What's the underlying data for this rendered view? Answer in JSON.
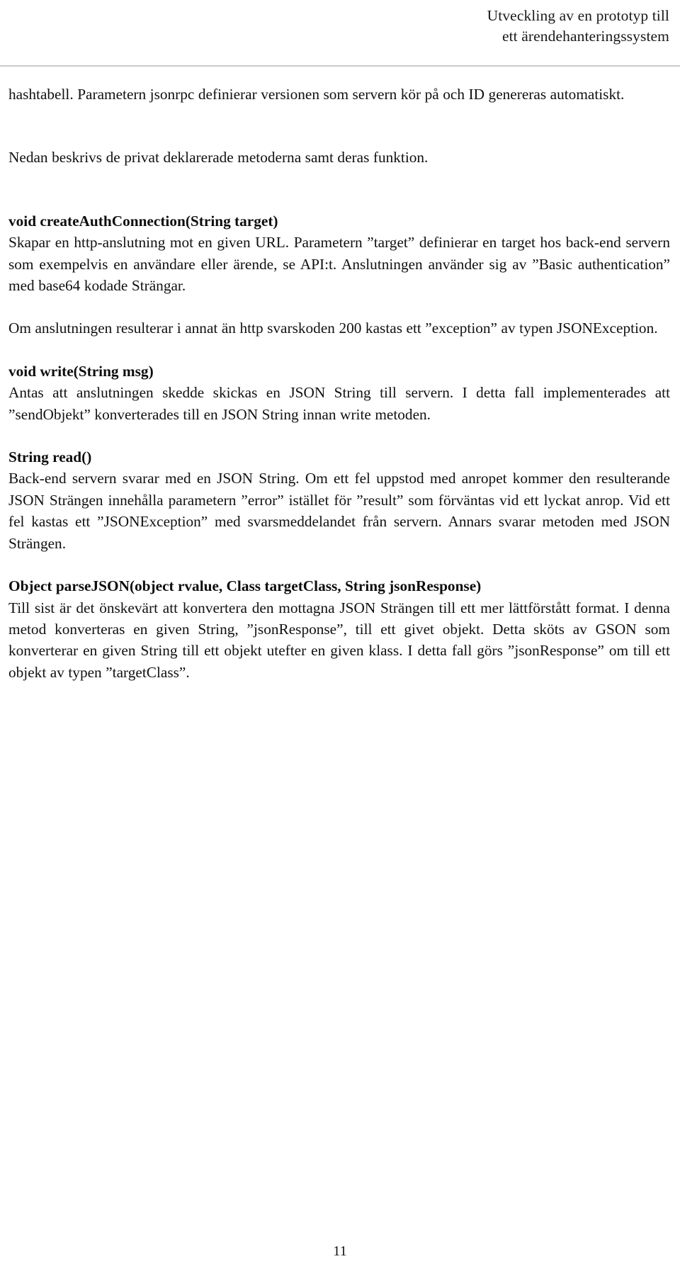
{
  "document": {
    "language": "sv",
    "page_number": "11",
    "header": {
      "line1": "Utveckling av en prototyp till",
      "line2": "ett ärendehanteringssystem"
    },
    "body": {
      "paragraph_continued": "hashtabell. Parametern jsonrpc definierar versionen som servern kör på och ID genereras automatiskt.",
      "paragraph_intro": "Nedan beskrivs de privat deklarerade metoderna samt deras funktion.",
      "sections": [
        {
          "heading": "void createAuthConnection(String target)",
          "paragraphs": [
            "Skapar en http-anslutning mot en given URL. Parametern ”target” definierar en target hos back-end servern som exempelvis en användare eller ärende, se API:t. Anslutningen använder sig av ”Basic authentication” med base64 kodade Strängar.",
            "Om anslutningen resulterar i annat än http svarskoden 200 kastas ett ”exception” av typen JSONException."
          ]
        },
        {
          "heading": "void write(String msg)",
          "paragraphs": [
            "Antas att anslutningen skedde skickas en JSON String till servern. I detta fall implementerades att ”sendObjekt” konverterades till en JSON String innan write metoden."
          ]
        },
        {
          "heading": "String read()",
          "paragraphs": [
            "Back-end servern svarar med en JSON String. Om ett fel uppstod med anropet kommer den resulterande JSON Strängen innehålla parametern ”error” istället för ”result” som förväntas vid ett lyckat anrop. Vid ett fel kastas ett ”JSONException” med svarsmeddelandet från servern. Annars svarar metoden med JSON Strängen."
          ]
        },
        {
          "heading": "Object parseJSON(object rvalue, Class targetClass, String jsonResponse)",
          "paragraphs": [
            "Till sist är det önskevärt att konvertera den mottagna JSON Strängen till ett mer lättförstått format. I denna metod konverteras en given String, ”jsonResponse”, till ett givet objekt. Detta sköts av GSON som konverterar en given String till ett objekt utefter en given klass. I detta fall görs ”jsonResponse” om till ett objekt av typen ”targetClass”."
          ]
        }
      ]
    },
    "colors": {
      "text": "#111111",
      "rule": "#c9cace",
      "background": "#ffffff"
    }
  }
}
